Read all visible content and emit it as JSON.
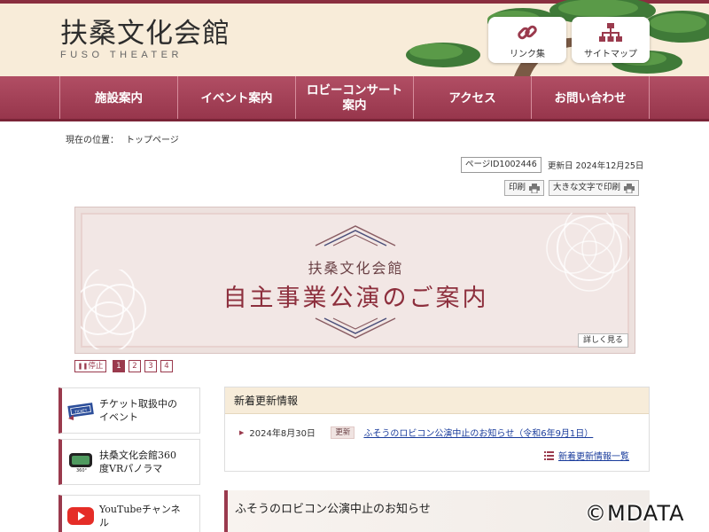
{
  "header": {
    "logo_main": "扶桑文化会館",
    "logo_sub": "FUSO THEATER",
    "links_button_label": "リンク集",
    "sitemap_button_label": "サイトマップ"
  },
  "nav": {
    "items": [
      {
        "label": "施設案内"
      },
      {
        "label": "イベント案内"
      },
      {
        "label": "ロビーコンサート\n案内"
      },
      {
        "label": "アクセス"
      },
      {
        "label": "お問い合わせ"
      }
    ]
  },
  "breadcrumb": {
    "label": "現在の位置：",
    "current": "トップページ"
  },
  "meta": {
    "page_id": "ページID1002446",
    "updated": "更新日 2024年12月25日",
    "print_label": "印刷",
    "large_print_label": "大きな文字で印刷"
  },
  "banner": {
    "title_small": "扶桑文化会館",
    "title_large": "自主事業公演のご案内",
    "more_label": "詳しく見る"
  },
  "slider": {
    "stop_label": "停止",
    "pages": [
      "1",
      "2",
      "3",
      "4"
    ],
    "active_page": 1
  },
  "side_links": [
    {
      "label": "チケット取扱中の\nイベント"
    },
    {
      "label": "扶桑文化会館360\n度VRパノラマ"
    },
    {
      "label": "YouTubeチャンネ\nル"
    }
  ],
  "news": {
    "heading": "新着更新情報",
    "items": [
      {
        "date": "2024年8月30日",
        "badge": "更新",
        "title": "ふそうのロビコン公演中止のお知らせ（令和6年9月1日）"
      }
    ],
    "more_label": "新着更新情報一覧"
  },
  "article": {
    "heading": "ふそうのロビコン公演中止のお知らせ"
  },
  "watermark": "©MDATA",
  "colors": {
    "brand": "#9a3a4d",
    "header_bg": "#f8ecd9",
    "link": "#1a3c9c"
  }
}
